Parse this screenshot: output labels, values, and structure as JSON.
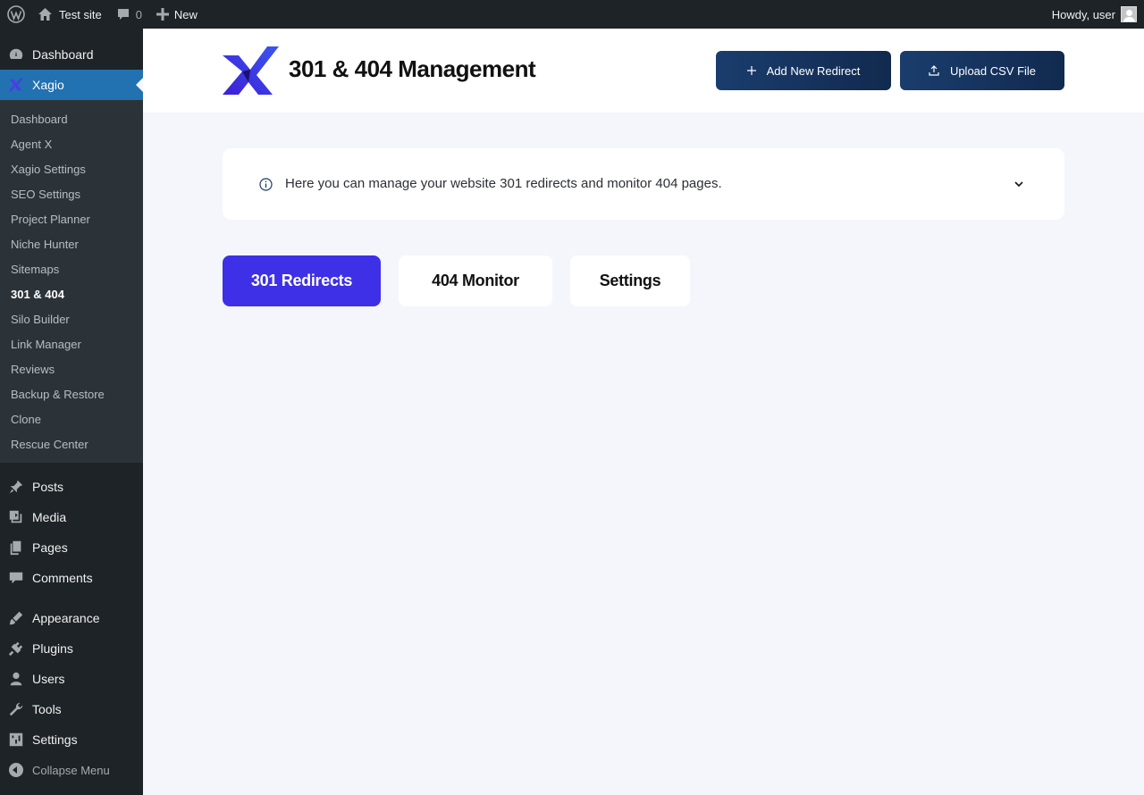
{
  "adminbar": {
    "site_name": "Test site",
    "comments_count": "0",
    "new_label": "New",
    "greeting": "Howdy, user"
  },
  "sidebar": {
    "top_items": [
      {
        "label": "Dashboard",
        "icon": "dashboard-icon"
      },
      {
        "label": "Xagio",
        "icon": "xagio-icon"
      }
    ],
    "submenu": [
      "Dashboard",
      "Agent X",
      "Xagio Settings",
      "SEO Settings",
      "Project Planner",
      "Niche Hunter",
      "Sitemaps",
      "301 & 404",
      "Silo Builder",
      "Link Manager",
      "Reviews",
      "Backup & Restore",
      "Clone",
      "Rescue Center"
    ],
    "active_submenu": "301 & 404",
    "group2": [
      {
        "label": "Posts",
        "icon": "pin-icon"
      },
      {
        "label": "Media",
        "icon": "media-icon"
      },
      {
        "label": "Pages",
        "icon": "pages-icon"
      },
      {
        "label": "Comments",
        "icon": "comments-icon"
      }
    ],
    "group3": [
      {
        "label": "Appearance",
        "icon": "brush-icon"
      },
      {
        "label": "Plugins",
        "icon": "plug-icon"
      },
      {
        "label": "Users",
        "icon": "user-icon"
      },
      {
        "label": "Tools",
        "icon": "wrench-icon"
      },
      {
        "label": "Settings",
        "icon": "sliders-icon"
      }
    ],
    "collapse_label": "Collapse Menu"
  },
  "header": {
    "title": "301 & 404 Management",
    "add_button": "Add New Redirect",
    "upload_button": "Upload CSV File"
  },
  "info": {
    "text": "Here you can manage your website 301 redirects and monitor 404 pages."
  },
  "tabs": [
    {
      "label": "301 Redirects",
      "active": true
    },
    {
      "label": "404 Monitor",
      "active": false
    },
    {
      "label": "Settings",
      "active": false
    }
  ],
  "colors": {
    "accent": "#3d30e6",
    "button_dark": "#1a3d6d",
    "admin_bg": "#1d2327",
    "wp_blue": "#2271b1",
    "page_bg": "#f5f6fb"
  }
}
